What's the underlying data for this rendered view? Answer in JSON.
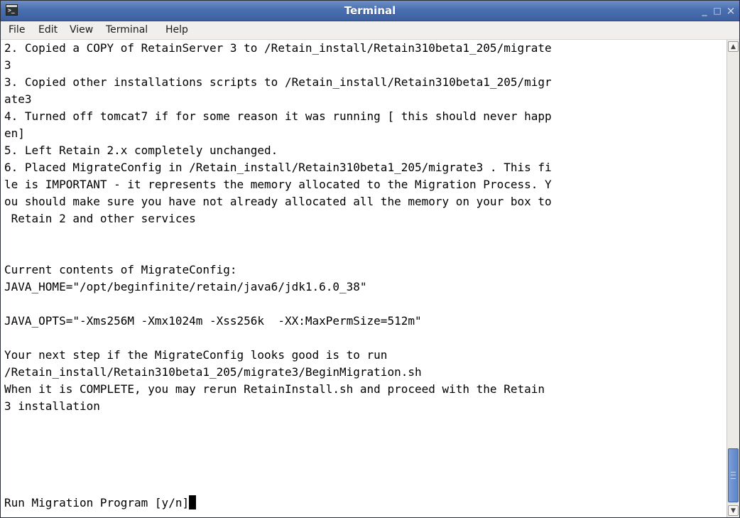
{
  "window": {
    "title": "Terminal",
    "app_icon": "terminal-icon",
    "app_icon_glyph": ">_",
    "controls": {
      "minimize": "_",
      "maximize": "□",
      "close": "×"
    }
  },
  "menu": [
    "File",
    "Edit",
    "View",
    "Terminal",
    "Help"
  ],
  "terminal": {
    "lines": [
      "2. Copied a COPY of RetainServer 3 to /Retain_install/Retain310beta1_205/migrate",
      "3",
      "3. Copied other installations scripts to /Retain_install/Retain310beta1_205/migr",
      "ate3",
      "4. Turned off tomcat7 if for some reason it was running [ this should never happ",
      "en]",
      "5. Left Retain 2.x completely unchanged.",
      "6. Placed MigrateConfig in /Retain_install/Retain310beta1_205/migrate3 . This fi",
      "le is IMPORTANT - it represents the memory allocated to the Migration Process. Y",
      "ou should make sure you have not already allocated all the memory on your box to",
      " Retain 2 and other services",
      "",
      "",
      "Current contents of MigrateConfig:",
      "JAVA_HOME=\"/opt/beginfinite/retain/java6/jdk1.6.0_38\"",
      "",
      "JAVA_OPTS=\"-Xms256M -Xmx1024m -Xss256k  -XX:MaxPermSize=512m\"",
      "",
      "Your next step if the MigrateConfig looks good is to run",
      "/Retain_install/Retain310beta1_205/migrate3/BeginMigration.sh",
      "When it is COMPLETE, you may rerun RetainInstall.sh and proceed with the Retain",
      "3 installation",
      "",
      "Run Migration Program [y/n]"
    ]
  },
  "scrollbar": {
    "up_arrow": "▲",
    "down_arrow": "▼"
  }
}
